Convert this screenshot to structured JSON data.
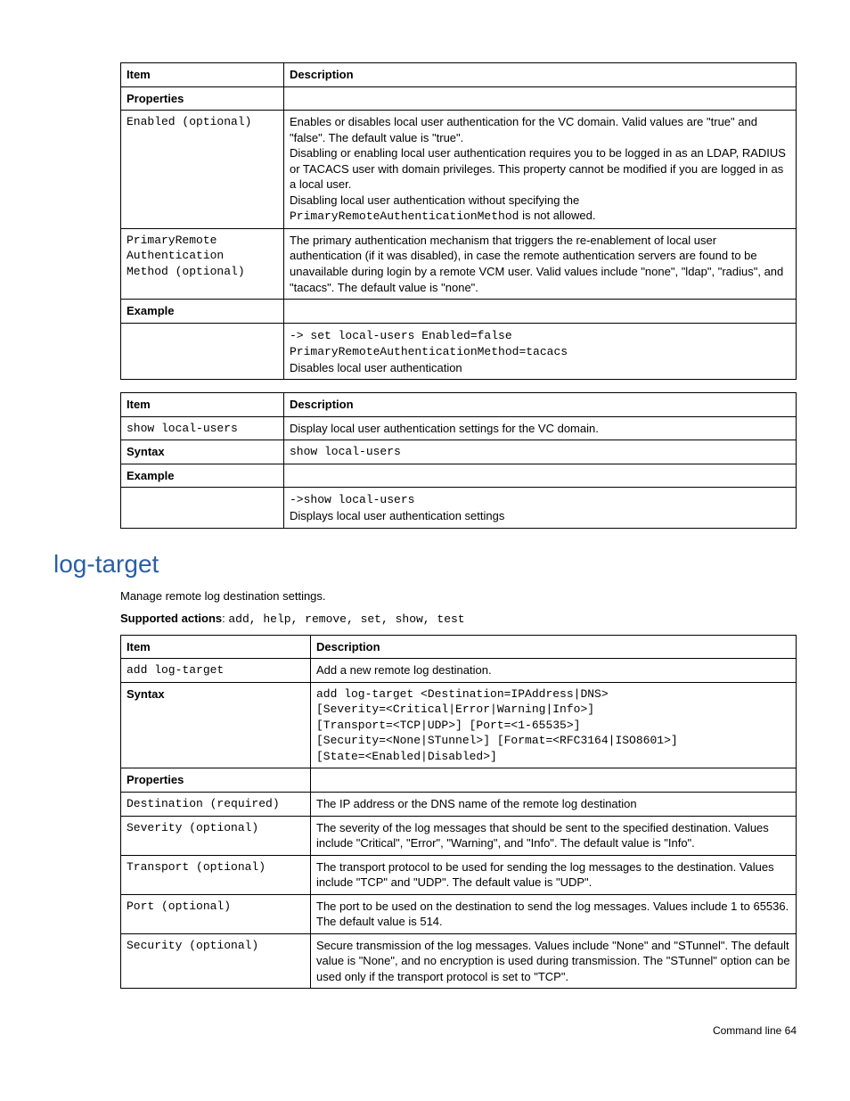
{
  "table1": {
    "head_item": "Item",
    "head_desc": "Description",
    "properties_label": "Properties",
    "enabled_item": "Enabled (optional)",
    "enabled_desc_1": "Enables or disables local user authentication for the VC domain. Valid values are \"true\" and \"false\". The default value is \"true\".",
    "enabled_desc_2": "Disabling or enabling local user authentication requires you to be logged in as an LDAP, RADIUS or TACACS user with domain privileges. This property cannot be modified if you are logged in as a local user.",
    "enabled_desc_3a": "Disabling local user authentication without specifying the ",
    "enabled_desc_3b": "PrimaryRemoteAuthenticationMethod",
    "enabled_desc_3c": " is not allowed.",
    "pram_item": "PrimaryRemote\nAuthentication\nMethod (optional)",
    "pram_desc": "The primary authentication mechanism that triggers the re-enablement of local user authentication (if it was disabled), in case the remote authentication servers are found to be unavailable during login by a remote VCM user. Valid values include \"none\", \"ldap\", \"radius\", and \"tacacs\". The default value is \"none\".",
    "example_label": "Example",
    "ex_line1": "-> set local-users Enabled=false",
    "ex_line2": "PrimaryRemoteAuthenticationMethod=tacacs",
    "ex_line3": "Disables local user authentication"
  },
  "table2": {
    "head_item": "Item",
    "head_desc": "Description",
    "show_item": "show local-users",
    "show_desc": "Display local user authentication settings for the VC domain.",
    "syntax_label": "Syntax",
    "syntax_val": "show local-users",
    "example_label": "Example",
    "ex_line1": "->show local-users",
    "ex_line2": "Displays local user authentication settings"
  },
  "section": {
    "heading": "log-target",
    "intro": "Manage remote log destination settings.",
    "supported_label": "Supported actions",
    "supported_sep": ": ",
    "supported_vals": "add, help, remove, set, show, test"
  },
  "table3": {
    "head_item": "Item",
    "head_desc": "Description",
    "add_item": "add log-target",
    "add_desc": "Add a new remote log destination.",
    "syntax_label": "Syntax",
    "syntax_l1": "add log-target <Destination=IPAddress|DNS>",
    "syntax_l2": "[Severity=<Critical|Error|Warning|Info>]",
    "syntax_l3": "[Transport=<TCP|UDP>] [Port=<1-65535>]",
    "syntax_l4": "[Security=<None|STunnel>] [Format=<RFC3164|ISO8601>]",
    "syntax_l5": "[State=<Enabled|Disabled>]",
    "properties_label": "Properties",
    "dest_item": "Destination (required)",
    "dest_desc": "The IP address or the DNS name of the remote log destination",
    "sev_item": "Severity (optional)",
    "sev_desc": "The severity of the log messages that should be sent to the specified destination. Values include \"Critical\", \"Error\", \"Warning\", and \"Info\". The default value is \"Info\".",
    "trans_item": "Transport (optional)",
    "trans_desc": "The transport protocol to be used for sending the log messages to the destination. Values include \"TCP\" and \"UDP\". The default value is \"UDP\".",
    "port_item": "Port (optional)",
    "port_desc": "The port to be used on the destination to send the log messages. Values include 1 to 65536. The default value is 514.",
    "sec_item": "Security (optional)",
    "sec_desc": "Secure transmission of the log messages. Values include \"None\" and \"STunnel\". The default value is \"None\", and no encryption is used during transmission. The \"STunnel\" option can be used only if the transport protocol is set to \"TCP\"."
  },
  "footer": {
    "text": "Command line   64"
  }
}
